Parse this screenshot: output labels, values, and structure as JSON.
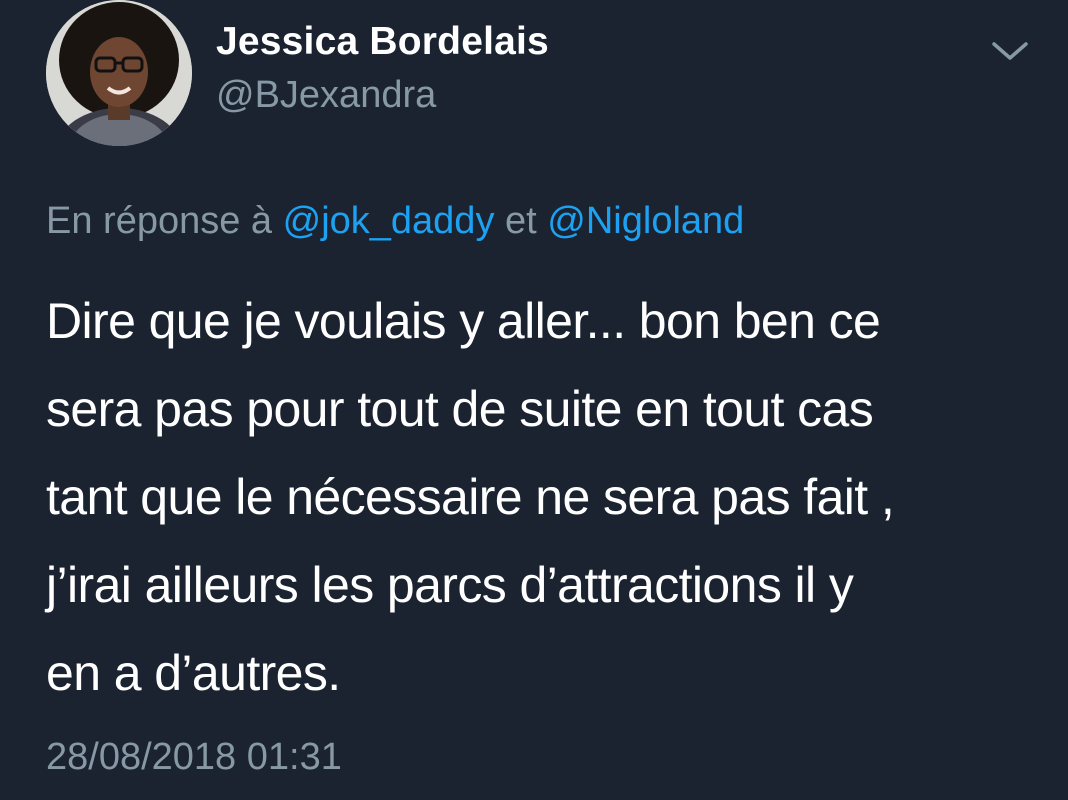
{
  "author": {
    "name": "Jessica Bordelais",
    "handle": "@BJexandra"
  },
  "menu_icon": "chevron-down-icon",
  "reply": {
    "prefix": "En réponse à",
    "mention_1": "@jok_daddy",
    "conjunction": "et",
    "mention_2": "@Nigloland"
  },
  "tweet": {
    "lines": [
      "Dire que je voulais y aller... bon ben ce",
      "sera pas pour tout de suite en tout cas",
      "tant que le nécessaire ne sera pas fait ,",
      "j’irai ailleurs les parcs d’attractions il y",
      "en a d’autres."
    ]
  },
  "timestamp": "28/08/2018 01:31",
  "colors": {
    "background": "#1b2330",
    "text_primary": "#ffffff",
    "text_secondary": "#8899a6",
    "link": "#1da1f2"
  }
}
